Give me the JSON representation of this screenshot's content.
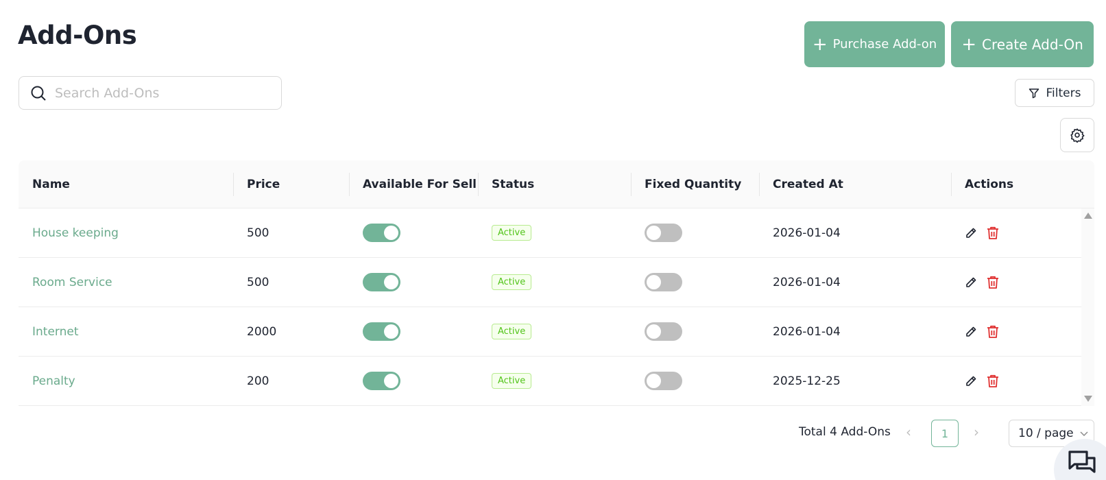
{
  "header": {
    "title": "Add-Ons",
    "purchase_label": "Purchase Add-on",
    "create_label": "Create Add-On"
  },
  "search": {
    "placeholder": "Search Add-Ons"
  },
  "filters_label": "Filters",
  "table": {
    "columns": [
      "Name",
      "Price",
      "Available For Sell",
      "Status",
      "Fixed Quantity",
      "Created At",
      "Actions"
    ],
    "rows": [
      {
        "name": "House keeping",
        "price": "500",
        "available": true,
        "status": "Active",
        "fixed_quantity": false,
        "created_at": "2026-01-04"
      },
      {
        "name": "Room Service",
        "price": "500",
        "available": true,
        "status": "Active",
        "fixed_quantity": false,
        "created_at": "2026-01-04"
      },
      {
        "name": "Internet",
        "price": "2000",
        "available": true,
        "status": "Active",
        "fixed_quantity": false,
        "created_at": "2026-01-04"
      },
      {
        "name": "Penalty",
        "price": "200",
        "available": true,
        "status": "Active",
        "fixed_quantity": false,
        "created_at": "2025-12-25"
      }
    ]
  },
  "pagination": {
    "total_text": "Total 4 Add-Ons",
    "current_page": "1",
    "page_size": "10 / page"
  },
  "colors": {
    "accent": "#72b498",
    "link": "#6aaa8c",
    "danger": "#e03131",
    "status_green": "#52c41a"
  },
  "icons": [
    "search-icon",
    "plus-icon",
    "filter-icon",
    "gear-icon",
    "pencil-icon",
    "trash-icon",
    "chevron-left-icon",
    "chevron-right-icon",
    "chevron-down-icon",
    "chat-icon"
  ]
}
